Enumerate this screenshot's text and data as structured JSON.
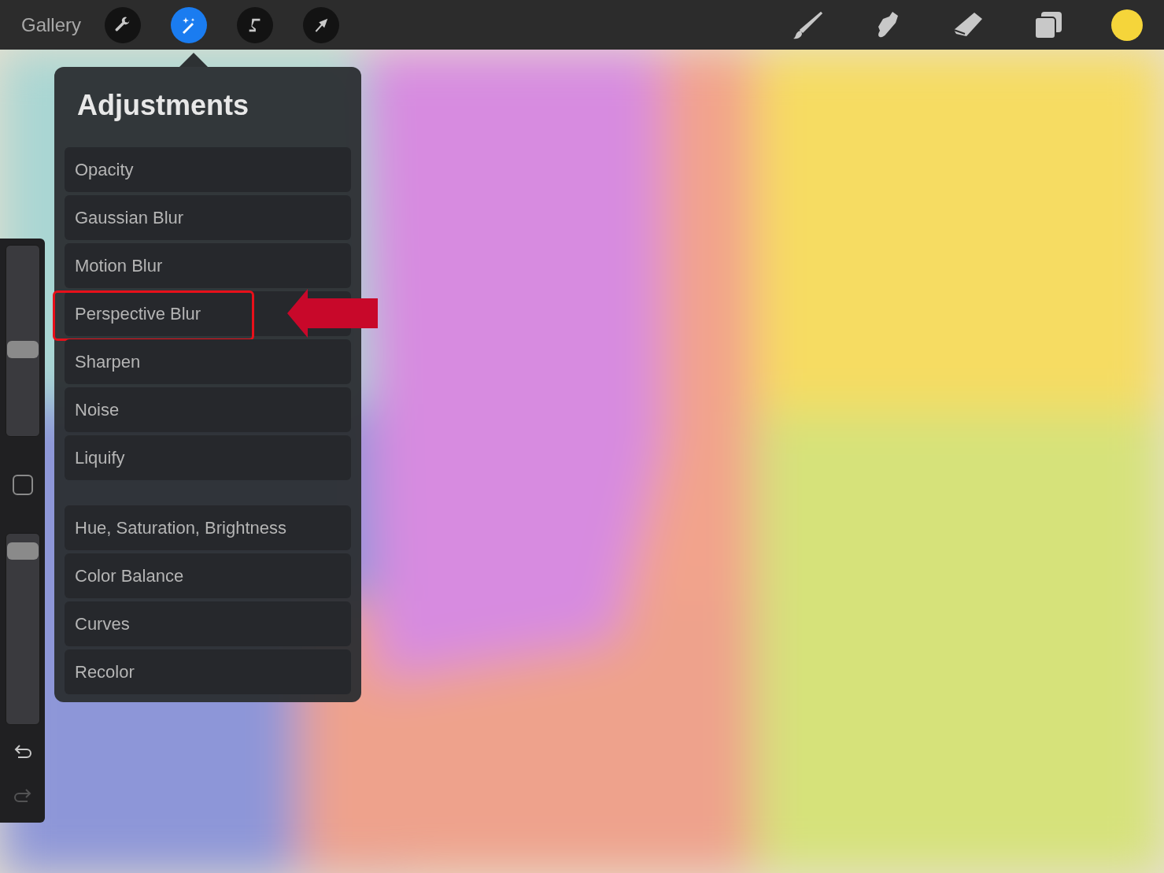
{
  "toolbar": {
    "gallery": "Gallery",
    "left_tools": [
      {
        "kind": "wrench",
        "selected": false
      },
      {
        "kind": "wand",
        "selected": true
      },
      {
        "kind": "selection",
        "selected": false
      },
      {
        "kind": "transform",
        "selected": false
      }
    ],
    "right_tools": [
      {
        "kind": "brush",
        "selected": false
      },
      {
        "kind": "smudge",
        "selected": false
      },
      {
        "kind": "eraser",
        "selected": false
      },
      {
        "kind": "layers",
        "selected": false
      }
    ],
    "color": "#f5d53a"
  },
  "sidebar": {
    "size_slider": {
      "level": 0.45
    },
    "opacity_slider": {
      "level": 0.95
    },
    "undo": {
      "disabled": false
    },
    "redo": {
      "disabled": true
    }
  },
  "adjustments": {
    "title": "Adjustments",
    "groups": [
      [
        {
          "label": "Opacity",
          "annotated": false
        },
        {
          "label": "Gaussian Blur",
          "annotated": false
        },
        {
          "label": "Motion Blur",
          "annotated": false
        },
        {
          "label": "Perspective Blur",
          "annotated": true
        },
        {
          "label": "Sharpen",
          "annotated": false
        },
        {
          "label": "Noise",
          "annotated": false
        },
        {
          "label": "Liquify",
          "annotated": false
        }
      ],
      [
        {
          "label": "Hue, Saturation, Brightness",
          "annotated": false
        },
        {
          "label": "Color Balance",
          "annotated": false
        },
        {
          "label": "Curves",
          "annotated": false
        },
        {
          "label": "Recolor",
          "annotated": false
        }
      ]
    ]
  }
}
